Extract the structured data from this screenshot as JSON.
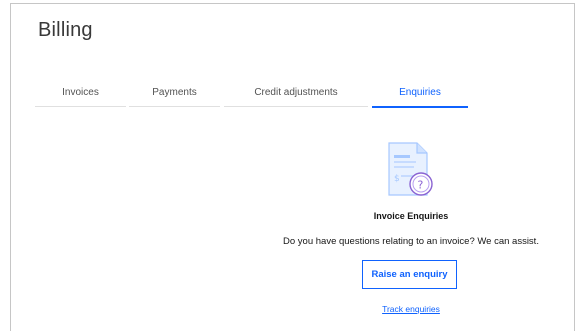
{
  "page": {
    "title": "Billing"
  },
  "tabs": [
    {
      "label": "Invoices"
    },
    {
      "label": "Payments"
    },
    {
      "label": "Credit adjustments"
    },
    {
      "label": "Enquiries"
    }
  ],
  "active_tab": "Enquiries",
  "enquiries": {
    "illustration_icon": "invoice-question-icon",
    "title": "Invoice Enquiries",
    "description": "Do you have questions relating to an invoice? We can assist.",
    "raise_button": "Raise an enquiry",
    "track_link": "Track enquiries"
  },
  "colors": {
    "accent": "#0f62fe",
    "illustration_blue": "#a6c8ff",
    "illustration_purple": "#8a63d2"
  }
}
